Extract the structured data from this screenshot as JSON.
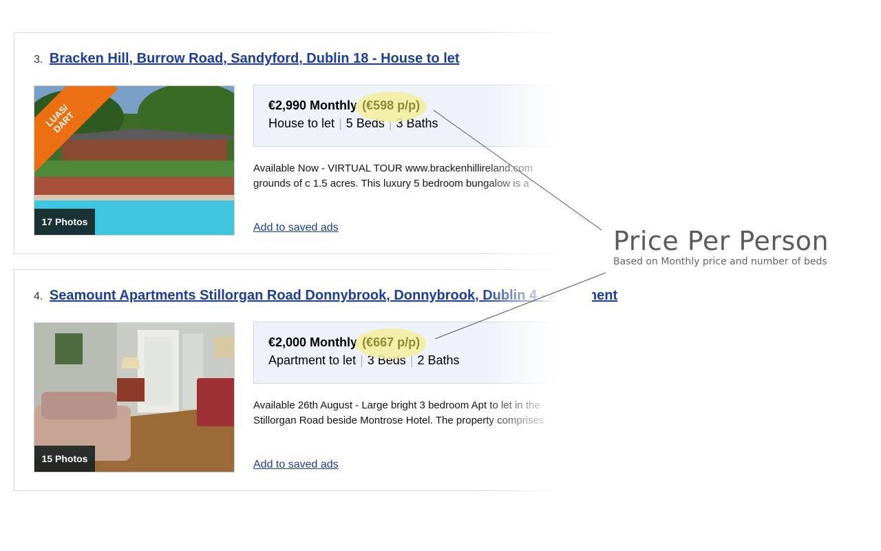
{
  "listings": [
    {
      "rank": "3.",
      "title": "Bracken Hill, Burrow Road, Sandyford, Dublin 18 - House to let",
      "ribbon_lines": [
        "LUAS/",
        "DART"
      ],
      "photo_count": "17 Photos",
      "price": "€2,990 Monthly",
      "price_per_person": "(€598 p/p)",
      "property_type": "House to let",
      "beds": "5 Beds",
      "baths": "3 Baths",
      "description_line1": "Available Now - VIRTUAL TOUR www.brackenhillireland.com",
      "description_line2": "grounds of c 1.5 acres. This luxury 5 bedroom bungalow is a",
      "saved_link": "Add to saved ads"
    },
    {
      "rank": "4.",
      "title": "Seamount Apartments Stillorgan Road Donnybrook, Donnybrook, Dublin 4 - Apartment",
      "photo_count": "15 Photos",
      "price": "€2,000 Monthly",
      "price_per_person": "(€667 p/p)",
      "property_type": "Apartment to let",
      "beds": "3 Beds",
      "baths": "2 Baths",
      "description_line1": "Available 26th August - Large bright 3 bedroom Apt to let in the",
      "description_line2": "Stillorgan Road beside Montrose Hotel. The property comprises",
      "saved_link": "Add to saved ads"
    }
  ],
  "callout": {
    "title": "Price Per Person",
    "subtitle": "Based on Monthly price and number of beds"
  },
  "colors": {
    "link": "#1a3d9f",
    "highlight": "#f2ee9c",
    "ribbon": "#ec7011",
    "price_box": "#eef2f9"
  }
}
